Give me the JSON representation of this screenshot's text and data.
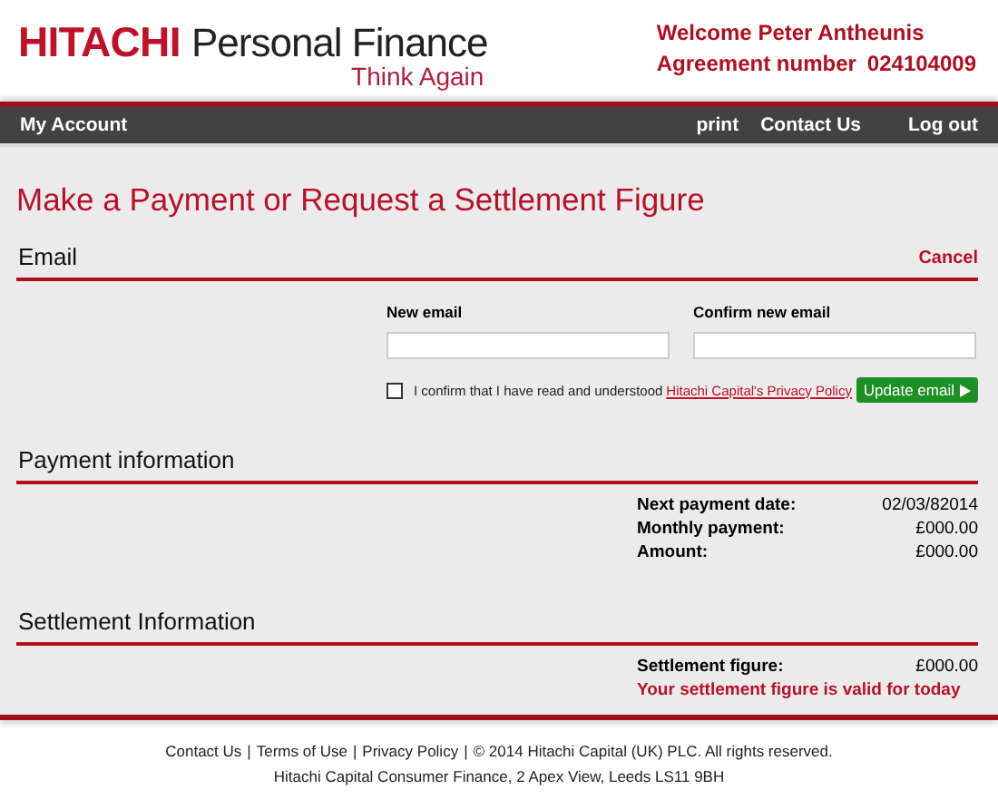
{
  "header": {
    "brand": "HITACHI",
    "product": "Personal Finance",
    "tagline": "Think Again",
    "welcome": "Welcome Peter Antheunis",
    "agreement_label": "Agreement number",
    "agreement_number": "024104009"
  },
  "nav": {
    "left": [
      "My Account"
    ],
    "right": [
      "print",
      "Contact Us",
      "Log out"
    ]
  },
  "page_title": "Make a Payment or Request a Settlement Figure",
  "email": {
    "heading": "Email",
    "cancel": "Cancel",
    "fields": [
      {
        "label": "New email"
      },
      {
        "label": "Confirm new email"
      }
    ],
    "confirm": {
      "checked": false,
      "text": "I confirm that I have read and understood",
      "link": "Hitachi Capital's Privacy Policy"
    },
    "button": "Update email"
  },
  "payment": {
    "heading": "Payment information",
    "rows": [
      {
        "label": "Next payment date:",
        "value": "02/03/82014"
      },
      {
        "label": "Monthly payment:",
        "value": "£000.00"
      },
      {
        "label": "Amount:",
        "value": "£000.00"
      }
    ]
  },
  "settlement": {
    "heading": "Settlement Information",
    "rows": [
      {
        "label": "Settlement figure:",
        "value": "£000.00"
      }
    ],
    "note": "Your settlement figure is valid for today"
  },
  "footer": {
    "links": [
      "Contact Us",
      "Terms of Use",
      "Privacy Policy"
    ],
    "separator": "|",
    "copyright": "© 2014 Hitachi Capital (UK) PLC. All rights reserved.",
    "address": "Hitachi Capital Consumer Finance, 2 Apex View, Leeds LS11 9BH"
  }
}
